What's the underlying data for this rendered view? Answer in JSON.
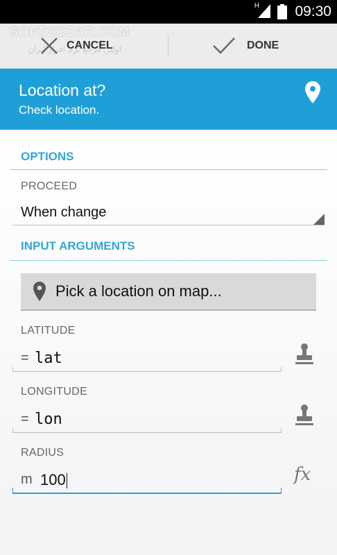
{
  "status_bar": {
    "time": "09:30",
    "network": "H"
  },
  "watermark": {
    "main": "SOFTGOZAR.COM",
    "sub": "اولین مرجع نرم افزار ایران"
  },
  "action_bar": {
    "cancel_label": "CANCEL",
    "done_label": "DONE"
  },
  "header": {
    "title": "Location at?",
    "subtitle": "Check location.",
    "accent_color": "#1f9fd8"
  },
  "options": {
    "section_label": "OPTIONS",
    "proceed_label": "PROCEED",
    "proceed_value": "When change"
  },
  "input_arguments": {
    "section_label": "INPUT ARGUMENTS",
    "pick_button_label": "Pick a location on map...",
    "latitude": {
      "label": "LATITUDE",
      "prefix": "=",
      "value": "lat"
    },
    "longitude": {
      "label": "LONGITUDE",
      "prefix": "=",
      "value": "lon"
    },
    "radius": {
      "label": "RADIUS",
      "prefix": "m",
      "value": "100"
    },
    "fx_label": "fx"
  }
}
